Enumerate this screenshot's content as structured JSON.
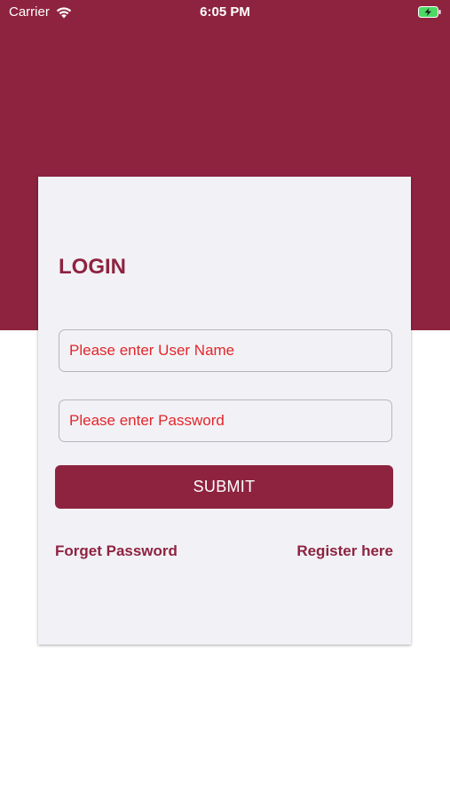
{
  "status_bar": {
    "carrier": "Carrier",
    "time": "6:05 PM",
    "wifi_icon": "wifi-icon",
    "battery_icon": "battery-charging-icon"
  },
  "colors": {
    "brand": "#8e2340",
    "placeholder": "#e3262b",
    "card_background": "#f2f2f6"
  },
  "login": {
    "title": "LOGIN",
    "username_placeholder": "Please enter User Name",
    "password_placeholder": "Please enter Password",
    "submit_label": "SUBMIT",
    "forget_password_label": "Forget Password",
    "register_label": "Register here"
  }
}
